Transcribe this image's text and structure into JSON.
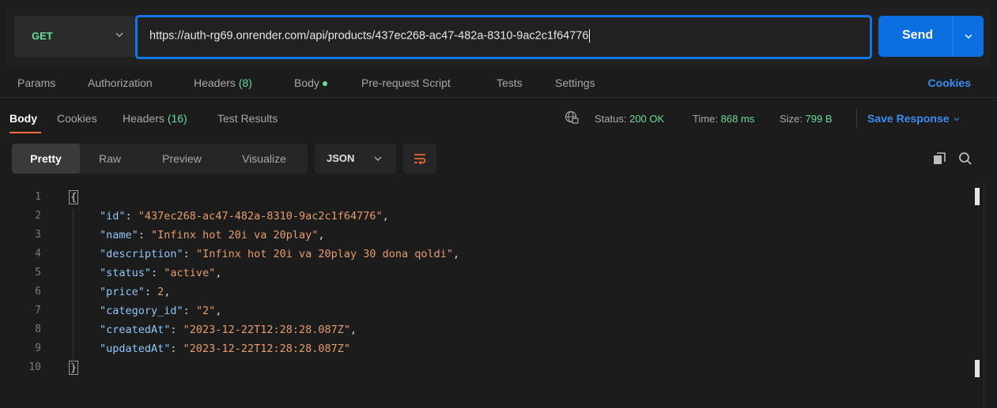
{
  "request": {
    "method": "GET",
    "url": "https://auth-rg69.onrender.com/api/products/437ec268-ac47-482a-8310-9ac2c1f64776",
    "send_label": "Send"
  },
  "request_tabs": {
    "params": "Params",
    "authorization": "Authorization",
    "headers": "Headers",
    "headers_count": "(8)",
    "body": "Body",
    "pre_request_script": "Pre-request Script",
    "tests": "Tests",
    "settings": "Settings",
    "cookies": "Cookies"
  },
  "response_tabs": {
    "body": "Body",
    "cookies": "Cookies",
    "headers": "Headers",
    "headers_count": "(16)",
    "test_results": "Test Results"
  },
  "response_meta": {
    "status_label": "Status:",
    "status_value": "200 OK",
    "time_label": "Time:",
    "time_value": "868 ms",
    "size_label": "Size:",
    "size_value": "799 B",
    "save_response": "Save Response"
  },
  "view": {
    "tabs": [
      "Pretty",
      "Raw",
      "Preview",
      "Visualize"
    ],
    "active": "Pretty",
    "format": "JSON"
  },
  "editor": {
    "line_numbers": [
      "1",
      "2",
      "3",
      "4",
      "5",
      "6",
      "7",
      "8",
      "9",
      "10"
    ],
    "open_brace": "{",
    "close_brace": "}",
    "fields": [
      {
        "key": "\"id\"",
        "value": "\"437ec268-ac47-482a-8310-9ac2c1f64776\"",
        "comma": ","
      },
      {
        "key": "\"name\"",
        "value": "\"Infinx hot 20i va 20play\"",
        "comma": ","
      },
      {
        "key": "\"description\"",
        "value": "\"Infinx hot 20i va 20play 30 dona qoldi\"",
        "comma": ","
      },
      {
        "key": "\"status\"",
        "value": "\"active\"",
        "comma": ","
      },
      {
        "key": "\"price\"",
        "value": "2",
        "comma": ","
      },
      {
        "key": "\"category_id\"",
        "value": "\"2\"",
        "comma": ","
      },
      {
        "key": "\"createdAt\"",
        "value": "\"2023-12-22T12:28:28.087Z\"",
        "comma": ","
      },
      {
        "key": "\"updatedAt\"",
        "value": "\"2023-12-22T12:28:28.087Z\"",
        "comma": ""
      }
    ]
  },
  "colors": {
    "accent": "#0b6fdf",
    "url_border": "#1177e8",
    "method_green": "#6bdd9a",
    "json_key": "#8fc7f7",
    "json_string": "#e69b6f",
    "tab_underline": "#ff6c37"
  }
}
